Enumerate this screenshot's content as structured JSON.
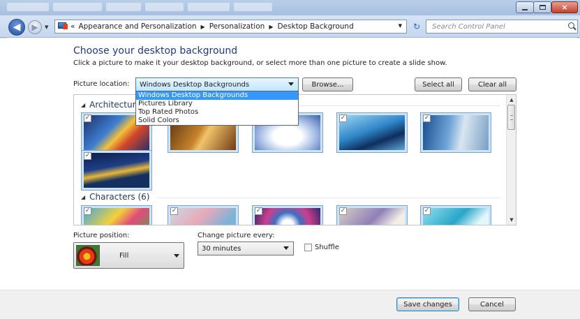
{
  "window": {
    "controls": {
      "minimize": "minimize",
      "maximize": "maximize",
      "close": "×"
    }
  },
  "nav": {
    "back_glyph": "◀",
    "forward_glyph": "▶",
    "dropdown_glyph": "▼",
    "address_prefix": "«",
    "breadcrumbs": [
      "Appearance and Personalization",
      "Personalization",
      "Desktop Background"
    ],
    "separator": "▶",
    "refresh_glyph": "↻",
    "search_placeholder": "Search Control Panel"
  },
  "page": {
    "heading": "Choose your desktop background",
    "subtext": "Click a picture to make it your desktop background, or select more than one picture to create a slide show.",
    "picture_location_label": "Picture location:",
    "picture_location_value": "Windows Desktop Backgrounds",
    "browse_label": "Browse...",
    "select_all_label": "Select all",
    "clear_all_label": "Clear all"
  },
  "dropdown_options": [
    "Windows Desktop Backgrounds",
    "Pictures Library",
    "Top Rated Photos",
    "Solid Colors"
  ],
  "groups": [
    {
      "name": "Architecture",
      "thumb_count": 6
    },
    {
      "name": "Characters (6)",
      "thumb_count": 5
    }
  ],
  "checkbox_glyph": "✓",
  "position": {
    "label": "Picture position:",
    "value": "Fill"
  },
  "change": {
    "label": "Change picture every:",
    "value": "30 minutes"
  },
  "shuffle": {
    "label": "Shuffle",
    "checked": false
  },
  "footer": {
    "save_label": "Save changes",
    "cancel_label": "Cancel"
  },
  "colors": {
    "heading": "#1f3a8a",
    "selection": "#3399ff",
    "thumb_selected_bg": "#cce4f7"
  }
}
